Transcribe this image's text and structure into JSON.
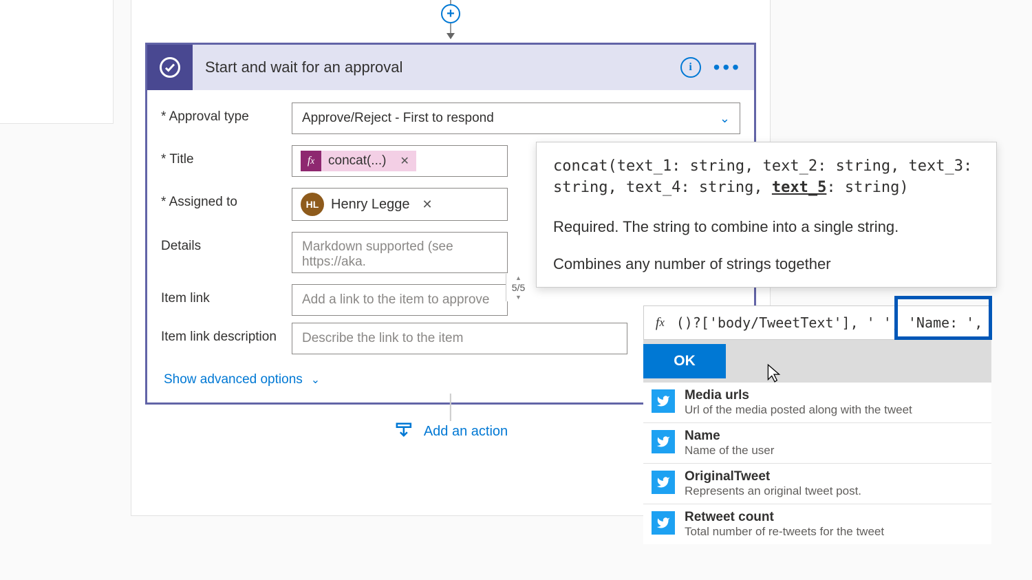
{
  "card": {
    "title": "Start and wait for an approval"
  },
  "fields": {
    "approval_type": {
      "label": "Approval type",
      "value": "Approve/Reject - First to respond"
    },
    "title": {
      "label": "Title",
      "token": "concat(...)"
    },
    "assigned_to": {
      "label": "Assigned to",
      "person_name": "Henry Legge",
      "initials": "HL"
    },
    "details": {
      "label": "Details",
      "placeholder": "Markdown supported (see https://aka."
    },
    "item_link": {
      "label": "Item link",
      "placeholder": "Add a link to the item to approve",
      "counter": "5/5"
    },
    "item_link_desc": {
      "label": "Item link description",
      "placeholder": "Describe the link to the item"
    }
  },
  "advanced_label": "Show advanced options",
  "add_action_label": "Add an action",
  "tooltip": {
    "signature_pre": "concat(text_1: string, text_2: string, text_3: string, text_4: string, ",
    "signature_param": "text_5",
    "signature_post": ": string)",
    "required": "Required. The string to combine into a single string.",
    "description": "Combines any number of strings together"
  },
  "expression": {
    "text": "()?['body/TweetText'], ' ', 'Name: ', |"
  },
  "ok_label": "OK",
  "suggestions": [
    {
      "title": "Media urls",
      "desc": "Url of the media posted along with the tweet"
    },
    {
      "title": "Name",
      "desc": "Name of the user"
    },
    {
      "title": "OriginalTweet",
      "desc": "Represents an original tweet post."
    },
    {
      "title": "Retweet count",
      "desc": "Total number of re-tweets for the tweet"
    }
  ]
}
